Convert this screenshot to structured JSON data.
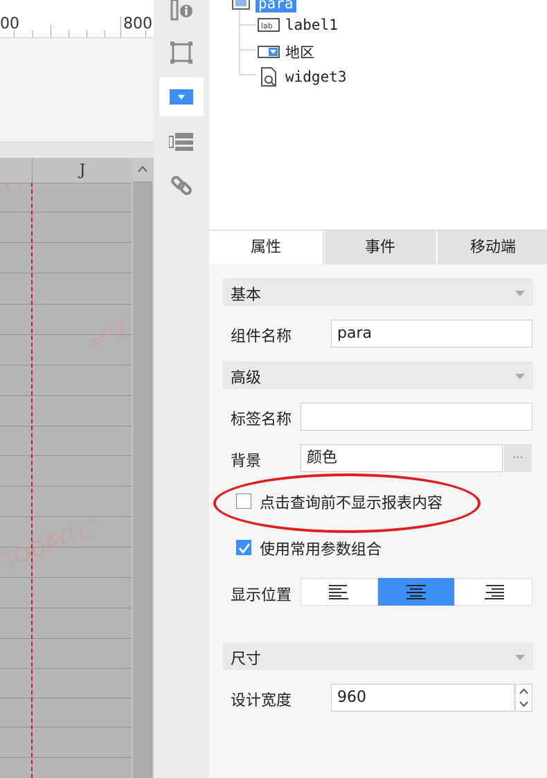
{
  "ruler": {
    "left_label": "00",
    "right_label": "800"
  },
  "grid": {
    "column_label": "J",
    "watermarks": [
      "YY",
      "=\"Z",
      "TODAY(),\""
    ]
  },
  "tree": {
    "items": [
      {
        "label": "para",
        "icon": "parameter-panel-icon",
        "selected": true
      },
      {
        "label": "label1",
        "icon": "label-widget-icon"
      },
      {
        "label": "地区",
        "icon": "dropdown-widget-icon"
      },
      {
        "label": "widget3",
        "icon": "query-widget-icon"
      }
    ]
  },
  "tabs": [
    {
      "label": "属性",
      "active": true
    },
    {
      "label": "事件",
      "active": false
    },
    {
      "label": "移动端",
      "active": false
    }
  ],
  "props": {
    "basic": {
      "title": "基本",
      "name_label": "组件名称",
      "name_value": "para"
    },
    "advanced": {
      "title": "高级",
      "tag_label": "标签名称",
      "tag_value": "",
      "bg_label": "背景",
      "bg_value": "颜色",
      "bg_more": "···",
      "hide_before_query": {
        "label": "点击查询前不显示报表内容",
        "checked": false
      },
      "use_common_params": {
        "label": "使用常用参数组合",
        "checked": true
      },
      "position_label": "显示位置",
      "position_options": [
        "left-align-icon",
        "center-align-icon",
        "right-align-icon"
      ],
      "position_selected": "center-align-icon"
    },
    "size": {
      "title": "尺寸",
      "width_label": "设计宽度",
      "width_value": "960"
    }
  },
  "colors": {
    "accent": "#3d8ef6",
    "highlight": "#e02020",
    "guide_line": "#c0281c"
  }
}
